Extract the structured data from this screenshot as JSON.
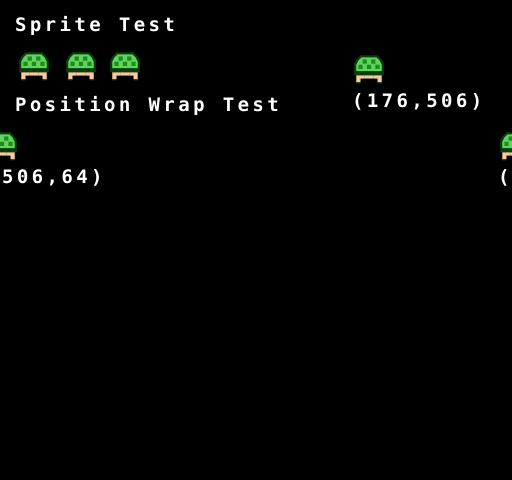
{
  "labels": {
    "title": "Sprite Test",
    "wrap_title": "Position Wrap Test",
    "coord_a": "(176,506)",
    "coord_b": "506,64)",
    "coord_c": "("
  },
  "colors": {
    "background": "#000000",
    "text": "#ffffff",
    "shell_light": "#5ed35e",
    "shell_dark": "#1f8a1f",
    "outline": "#0b3d0b",
    "skin": "#f6c9a0"
  },
  "sprites": {
    "icon": "turtle-shell-icon"
  }
}
